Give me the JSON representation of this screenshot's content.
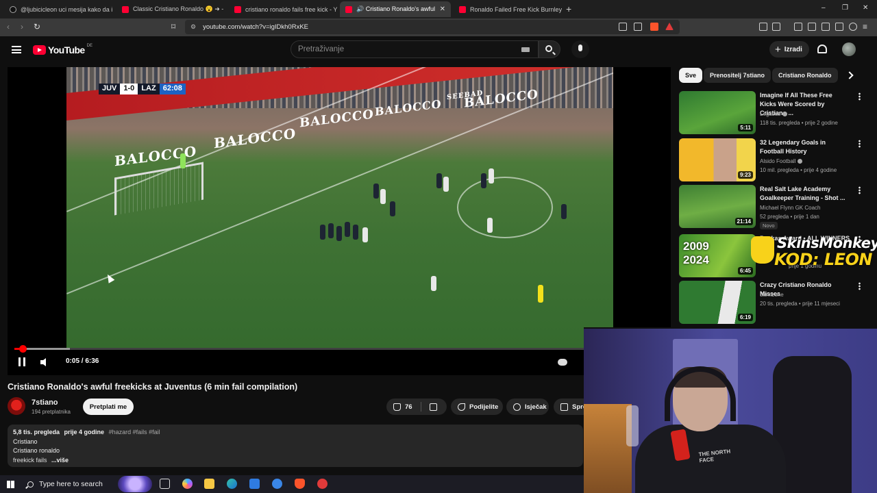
{
  "browser": {
    "tabs": [
      {
        "title": "@ljubicicleon uci mesija kako da igra",
        "icon": "tiktok-icon",
        "active": false
      },
      {
        "title": "Classic Cristiano Ronaldo 😮 ➜ - Yo",
        "icon": "youtube-icon",
        "active": false
      },
      {
        "title": "cristiano ronaldo fails free kick - You",
        "icon": "youtube-icon",
        "active": false
      },
      {
        "title": "🔊 Cristiano Ronaldo's awful free",
        "icon": "youtube-icon",
        "active": true
      },
      {
        "title": "Ronaldo Failed Free Kick Burnley - Yo",
        "icon": "youtube-icon",
        "active": false
      }
    ],
    "new_tab": "+",
    "window_controls": [
      "–",
      "❐",
      "✕"
    ],
    "url": "youtube.com/watch?v=igIDkh0RxKE"
  },
  "header": {
    "logo_text": "YouTube",
    "logo_region": "DE",
    "search_placeholder": "Pretraživanje",
    "create_label": "Izradi",
    "create_plus": "+"
  },
  "player": {
    "scoreboard": {
      "home": "JUV",
      "score": "1-0",
      "away": "LAZ",
      "clock": "62:08"
    },
    "ad_text": "BALOCCO",
    "ad_text_small": "SEEBAD",
    "current_time": "0:05",
    "duration": "6:36",
    "time_display": "0:05 / 6:36",
    "progress_played": 0.0126,
    "progress_buffered": 0.085
  },
  "video": {
    "title": "Cristiano Ronaldo's awful freekicks at Juventus (6 min fail compilation)",
    "channel": "7stiano",
    "subscribers": "194 pretplatnika",
    "subscribe_label": "Pretplati me",
    "likes": "76",
    "share_label": "Podijelite",
    "clip_label": "Isječak",
    "save_label": "Spre"
  },
  "description": {
    "views": "5,8 tis. pregleda",
    "age": "prije 4 godine",
    "hashtags": "#hazard #fails #fail",
    "lines": [
      "Cristiano",
      "Cristiano ronaldo",
      "freekick fails"
    ],
    "more_label": "...više"
  },
  "sidebar": {
    "chips": [
      "Sve",
      "Prenositelj 7stiano",
      "Cristiano Ronaldo"
    ],
    "recommendations": [
      {
        "title": "Imagine If All These Free Kicks Were Scored by Cristiano ...",
        "channel": "Legasus",
        "verified": true,
        "stats": "118 tis. pregleda • prije 2 godine",
        "duration": "5:11",
        "badge": ""
      },
      {
        "title": "32 Legendary Goals in Football History",
        "channel": "Alsido Football",
        "verified": true,
        "stats": "10 mil. pregleda • prije 4 godine",
        "duration": "9:23",
        "badge": ""
      },
      {
        "title": "Real Salt Lake Academy Goalkeeper Training - Shot ...",
        "channel": "Michael Flynn GK Coach",
        "verified": false,
        "stats": "52 pregleda • prije 1 dan",
        "duration": "21:14",
        "badge": "Novo"
      },
      {
        "title": "Puskas Award • ALL WINNERS",
        "channel": "",
        "verified": false,
        "stats": "prije 1 godinu",
        "duration": "6:45",
        "badge": "",
        "thumb_text": "2009 2024"
      },
      {
        "title": "Crazy Cristiano Ronaldo Misses",
        "channel": "damizone",
        "verified": false,
        "stats": "20 tis. pregleda • prije 11 mjeseci",
        "duration": "6:19",
        "badge": ""
      }
    ]
  },
  "overlay": {
    "line1": "SkinsMonkey",
    "line2": "KOD: LEON"
  },
  "webcam": {
    "shirt_text": "THE NORTH FACE"
  },
  "taskbar": {
    "search_placeholder": "Type here to search"
  },
  "colors": {
    "youtube_red": "#ff0033",
    "background": "#0f0f0f",
    "chip_bg": "#272727",
    "overlay_yellow": "#f8d21a"
  }
}
